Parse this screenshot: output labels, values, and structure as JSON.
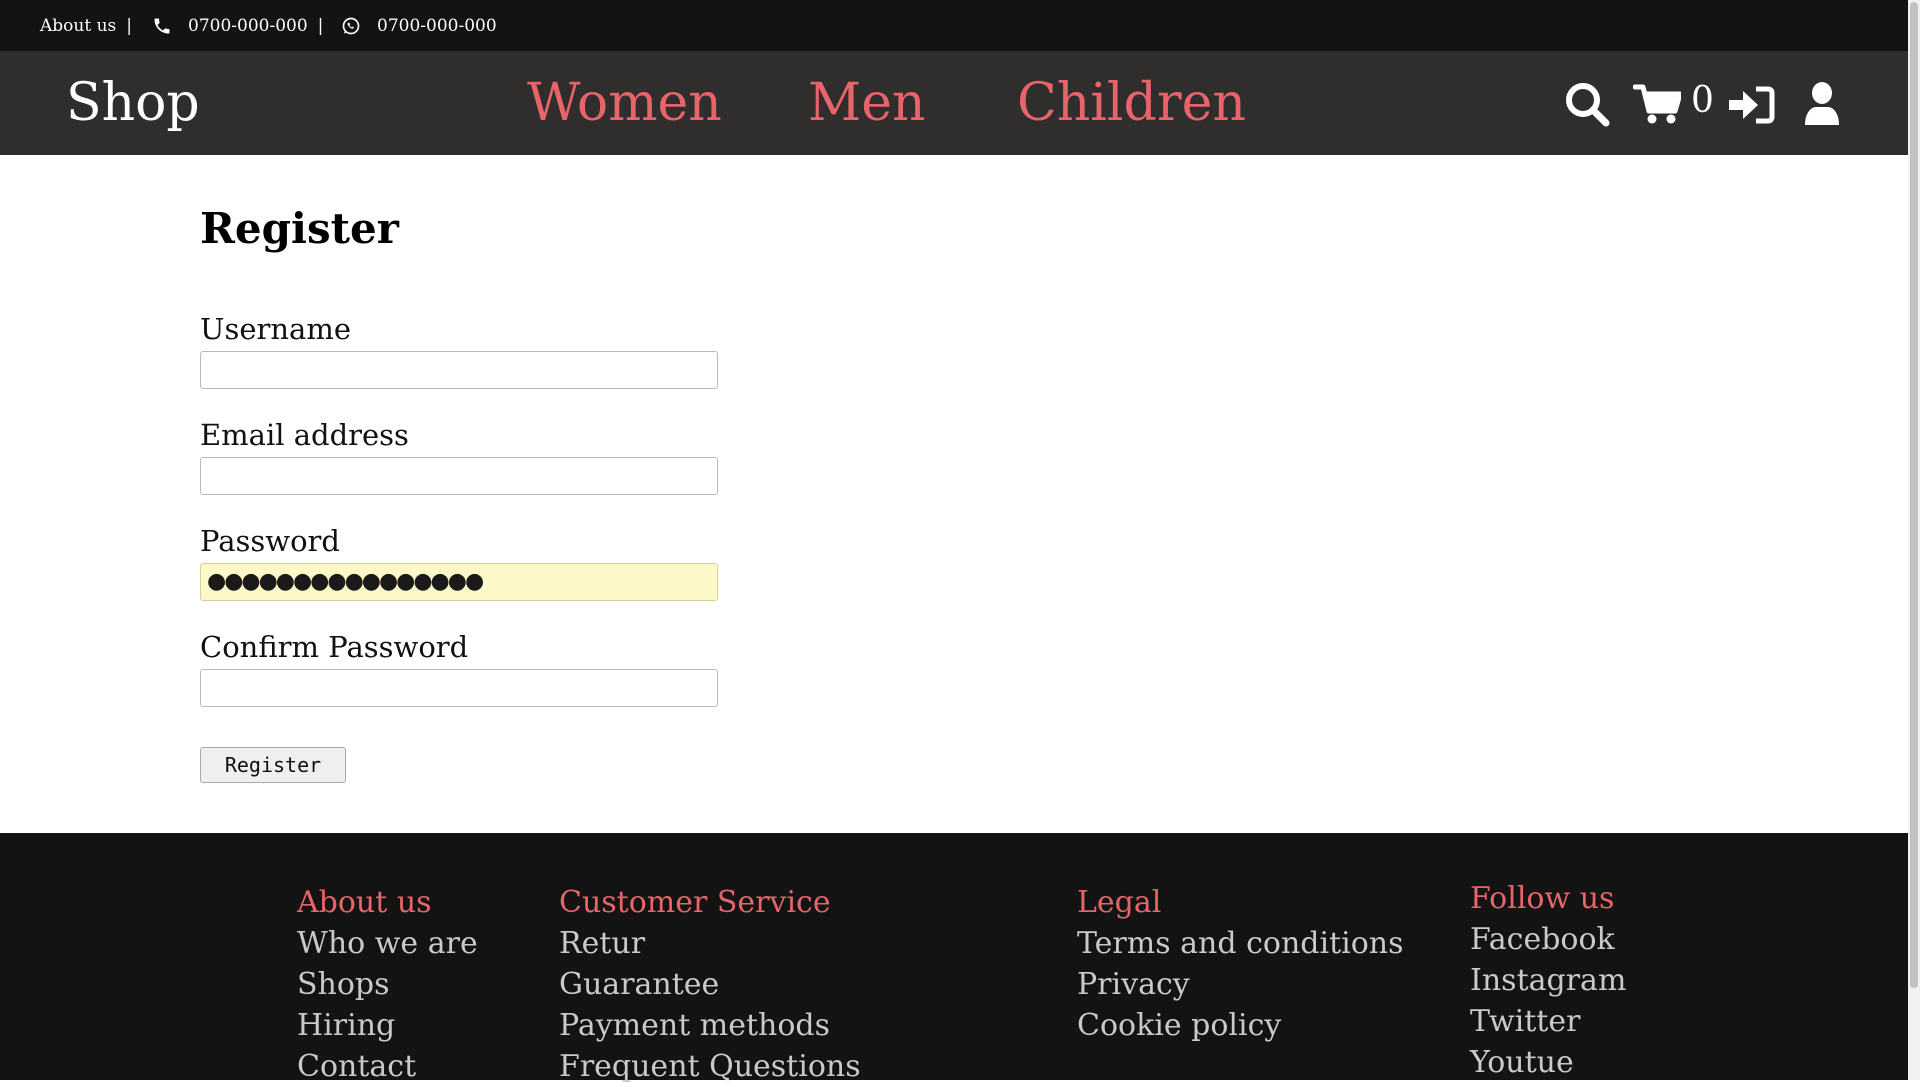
{
  "topbar": {
    "about": "About us",
    "separator": "|",
    "phone": "0700-000-000",
    "whatsapp": "0700-000-000",
    "phone_icon": "phone-icon",
    "whatsapp_icon": "whatsapp-icon"
  },
  "nav": {
    "brand": "Shop",
    "links": [
      "Women",
      "Men",
      "Children"
    ],
    "cart_count": "0",
    "icons": [
      "search-icon",
      "cart-icon",
      "sign-in-icon",
      "user-icon"
    ],
    "accent_color": "#e6646a"
  },
  "form": {
    "title": "Register",
    "username_label": "Username",
    "username_value": "",
    "email_label": "Email address",
    "email_value": "",
    "password_label": "Password",
    "password_masked": "●●●●●●●●●●●●●●●●",
    "confirm_label": "Confirm Password",
    "confirm_value": "",
    "submit_label": "Register"
  },
  "footer": {
    "columns": [
      {
        "heading": "About us",
        "links": [
          "Who we are",
          "Shops",
          "Hiring",
          "Contact"
        ]
      },
      {
        "heading": "Customer Service",
        "links": [
          "Retur",
          "Guarantee",
          "Payment methods",
          "Frequent Questions"
        ]
      },
      {
        "heading": "Legal",
        "links": [
          "Terms and conditions",
          "Privacy",
          "Cookie policy"
        ]
      },
      {
        "heading": "Follow us",
        "links": [
          "Facebook",
          "Instagram",
          "Twitter",
          "Youtue"
        ]
      }
    ]
  }
}
